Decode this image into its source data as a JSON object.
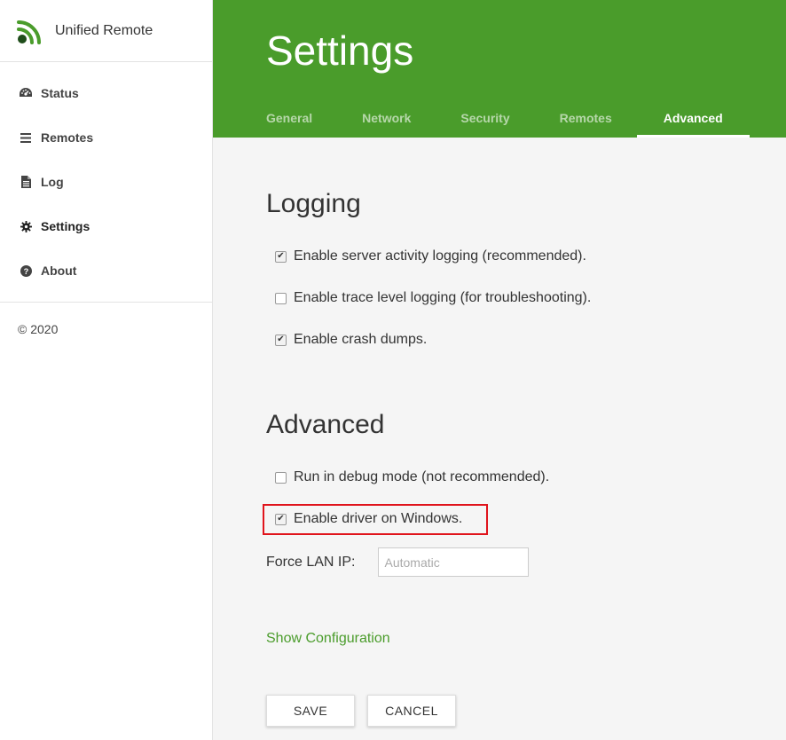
{
  "app": {
    "name": "Unified Remote",
    "copyright": "© 2020",
    "accent_color": "#4a9c2b"
  },
  "sidebar": {
    "items": [
      {
        "label": "Status",
        "icon": "dashboard-icon"
      },
      {
        "label": "Remotes",
        "icon": "list-icon"
      },
      {
        "label": "Log",
        "icon": "document-icon"
      },
      {
        "label": "Settings",
        "icon": "gear-icon",
        "active": true
      },
      {
        "label": "About",
        "icon": "question-circle-icon"
      }
    ]
  },
  "header": {
    "title": "Settings",
    "tabs": [
      {
        "label": "General"
      },
      {
        "label": "Network"
      },
      {
        "label": "Security"
      },
      {
        "label": "Remotes"
      },
      {
        "label": "Advanced",
        "active": true
      }
    ]
  },
  "logging": {
    "title": "Logging",
    "options": [
      {
        "label": "Enable server activity logging (recommended).",
        "checked": true
      },
      {
        "label": "Enable trace level logging (for troubleshooting).",
        "checked": false
      },
      {
        "label": "Enable crash dumps.",
        "checked": true
      }
    ]
  },
  "advanced": {
    "title": "Advanced",
    "options": [
      {
        "label": "Run in debug mode (not recommended).",
        "checked": false
      },
      {
        "label": "Enable driver on Windows.",
        "checked": true
      }
    ],
    "force_lan_ip": {
      "label": "Force LAN IP:",
      "value": "",
      "placeholder": "Automatic"
    },
    "highlight_color": "#e0141c"
  },
  "links": {
    "show_configuration": "Show Configuration"
  },
  "buttons": {
    "save": "SAVE",
    "cancel": "CANCEL"
  }
}
